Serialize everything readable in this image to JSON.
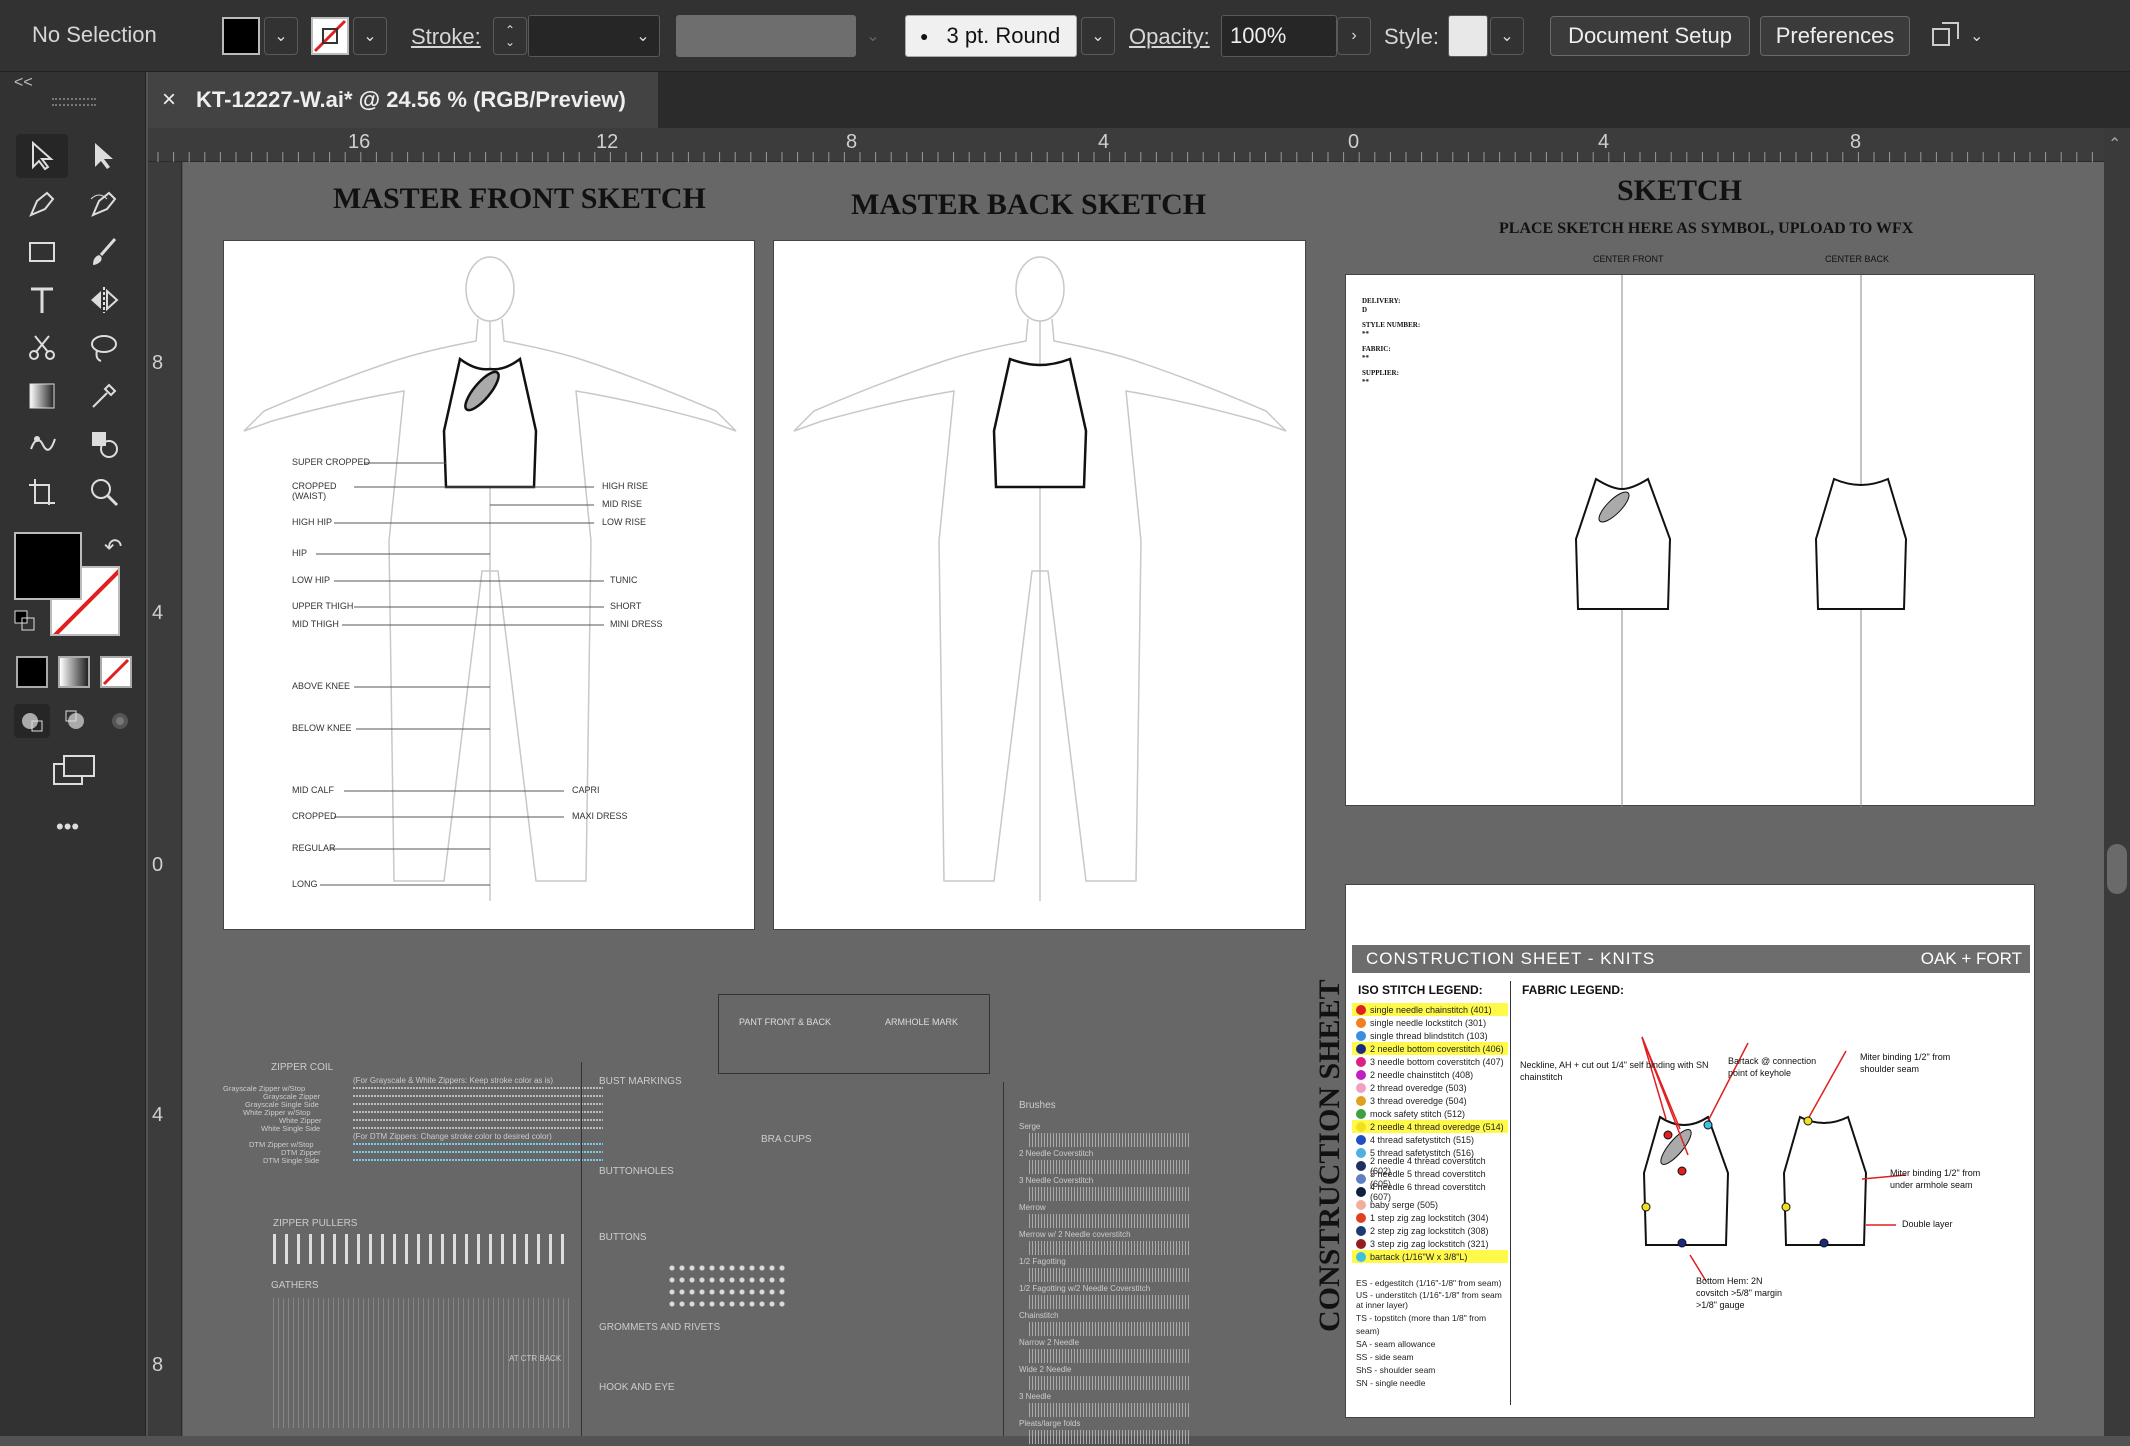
{
  "control_bar": {
    "selection": "No Selection",
    "stroke_label": "Stroke:",
    "brush_value": "3 pt. Round",
    "opacity_label": "Opacity:",
    "opacity_value": "100%",
    "style_label": "Style:",
    "document_setup": "Document Setup",
    "preferences": "Preferences"
  },
  "tab": {
    "title": "KT-12227-W.ai* @ 24.56 % (RGB/Preview)",
    "close": "×"
  },
  "panel_toggle": "<<",
  "more_tools": "•••",
  "ruler_h": [
    "16",
    "12",
    "8",
    "4",
    "0",
    "4",
    "8"
  ],
  "ruler_v": [
    "8",
    "4",
    "0",
    "4",
    "8"
  ],
  "artboards": {
    "front_title": "MASTER FRONT SKETCH",
    "back_title": "MASTER BACK SKETCH",
    "sketch_title": "SKETCH",
    "sketch_subtitle": "PLACE SKETCH HERE AS SYMBOL, UPLOAD TO WFX",
    "center_front": "CENTER FRONT",
    "center_back": "CENTER BACK",
    "sketch_fields": [
      "DELIVERY:",
      "D",
      "STYLE NUMBER:",
      "**",
      "FABRIC:",
      "**",
      "SUPPLIER:",
      "**"
    ],
    "construction_vertical": "CONSTRUCTION SHEET"
  },
  "front_labels_left": [
    "SUPER CROPPED",
    "CROPPED (WAIST)",
    "HIGH HIP",
    "HIP",
    "LOW HIP",
    "UPPER THIGH",
    "MID THIGH",
    "ABOVE KNEE",
    "BELOW KNEE",
    "MID CALF",
    "CROPPED",
    "REGULAR",
    "LONG"
  ],
  "front_labels_right": [
    "HIGH RISE",
    "MID RISE",
    "LOW RISE",
    "TUNIC",
    "SHORT",
    "MINI DRESS",
    "CAPRI",
    "MAXI DRESS"
  ],
  "construction": {
    "header": "CONSTRUCTION SHEET - KNITS",
    "brand": "OAK + FORT",
    "iso_title": "ISO STITCH LEGEND:",
    "fabric_title": "FABRIC LEGEND:",
    "legend": [
      {
        "text": "single needle chainstitch (401)",
        "color": "#e02020",
        "hl": true
      },
      {
        "text": "single needle lockstitch (301)",
        "color": "#f08020",
        "hl": false
      },
      {
        "text": "single thread blindstitch (103)",
        "color": "#3a8ee0",
        "hl": false
      },
      {
        "text": "2 needle bottom coverstitch (406)",
        "color": "#1a2a80",
        "hl": true
      },
      {
        "text": "3 needle bottom coverstitch (407)",
        "color": "#e02080",
        "hl": false
      },
      {
        "text": "2 needle chainstitch (408)",
        "color": "#c020c0",
        "hl": false
      },
      {
        "text": "2 thread overedge (503)",
        "color": "#f0a0c0",
        "hl": false
      },
      {
        "text": "3 thread overedge (504)",
        "color": "#e0a020",
        "hl": false
      },
      {
        "text": "mock safety stitch (512)",
        "color": "#40a040",
        "hl": false
      },
      {
        "text": "2 needle 4 thread overedge (514)",
        "color": "#f0e020",
        "hl": true
      },
      {
        "text": "4 thread safetystitch (515)",
        "color": "#2050c0",
        "hl": false
      },
      {
        "text": "5 thread safetystitch (516)",
        "color": "#50b0e0",
        "hl": false
      },
      {
        "text": "2 needle 4 thread coverstitch (602)",
        "color": "#203060",
        "hl": false
      },
      {
        "text": "3 needle 5 thread coverstitch (605)",
        "color": "#6080c0",
        "hl": false
      },
      {
        "text": "4 needle 6 thread coverstitch (607)",
        "color": "#102040",
        "hl": false
      },
      {
        "text": "baby serge (505)",
        "color": "#f0b0a0",
        "hl": false
      },
      {
        "text": "1 step zig zag lockstitch (304)",
        "color": "#e04020",
        "hl": false
      },
      {
        "text": "2 step zig zag lockstitch (308)",
        "color": "#1a3a70",
        "hl": false
      },
      {
        "text": "3 step zig zag lockstitch (321)",
        "color": "#902020",
        "hl": false
      },
      {
        "text": "bartack (1/16\"W x 3/8\"L)",
        "color": "#40c0e0",
        "hl": true
      }
    ],
    "abbreviations": [
      "ES - edgestitch (1/16\"-1/8\" from seam)",
      "US - understitch (1/16\"-1/8\" from seam at inner layer)",
      "TS - topstitch (more than 1/8\" from seam)",
      "SA - seam allowance",
      "SS - side seam",
      "ShS - shoulder seam",
      "SN - single needle"
    ],
    "callouts": {
      "neckline": "Neckline, AH + cut out 1/4\" self binding with SN chainstitch",
      "bartack": "Bartack @ connection point of keyhole",
      "miter_shoulder": "Miter binding 1/2\" from shoulder seam",
      "miter_armhole": "Miter binding 1/2\" from under armhole seam",
      "double_layer": "Double layer",
      "bottom_hem": "Bottom Hem: 2N covsitch >5/8\" margin >1/8\" gauge"
    }
  },
  "resources": {
    "zipper_coil": "ZIPPER COIL",
    "zipper_pullers": "ZIPPER PULLERS",
    "gathers": "GATHERS",
    "bust_markings": "BUST MARKINGS",
    "bra_cups": "BRA CUPS",
    "buttonholes": "BUTTONHOLES",
    "buttons": "BUTTONS",
    "grommets": "GROMMETS AND RIVETS",
    "hook_eye": "HOOK AND EYE",
    "brushes": "Brushes",
    "pant_front_back": "PANT FRONT & BACK",
    "armhole_mark": "ARMHOLE MARK",
    "at_ctr_back": "AT CTR BACK",
    "zipper_note1": "(For Grayscale & White Zippers: Keep stroke color as is)",
    "zipper_note2": "(For DTM Zippers: Change stroke color to desired color)",
    "zipper_rows": [
      "Grayscale Zipper w/Stop",
      "Grayscale Zipper",
      "Grayscale Single Side",
      "White Zipper w/Stop",
      "White Zipper",
      "White Single Side"
    ],
    "dtm_rows": [
      "DTM Zipper w/Stop",
      "DTM Zipper",
      "DTM Single Side"
    ],
    "brush_rows": [
      "Serge",
      "2 Needle Coverstitch",
      "3 Needle Coverstitch",
      "Merrow",
      "Merrow w/ 2 Needle coverstitch",
      "1/2 Fagotting",
      "1/2 Fagotting w/2 Needle Coverstitch",
      "Chainstitch",
      "Narrow 2 Needle",
      "Wide 2 Needle",
      "3 Needle",
      "Pleats/large folds"
    ]
  }
}
